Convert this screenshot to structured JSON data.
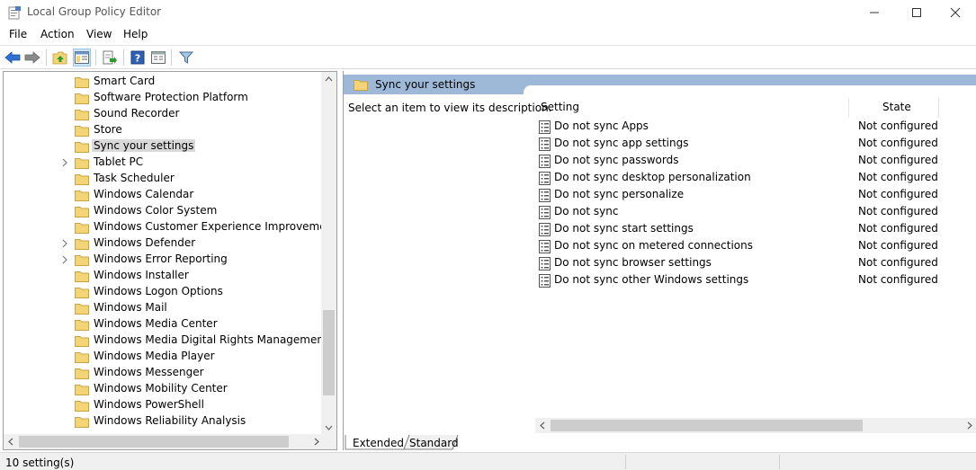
{
  "window": {
    "title": "Local Group Policy Editor"
  },
  "menu": {
    "items": [
      "File",
      "Action",
      "View",
      "Help"
    ]
  },
  "toolbar": {
    "buttons": [
      {
        "icon": "back-arrow-icon"
      },
      {
        "icon": "forward-arrow-icon"
      },
      {
        "icon": "up-folder-icon"
      },
      {
        "icon": "show-hide-tree-icon"
      },
      {
        "icon": "export-list-icon"
      },
      {
        "icon": "help-icon"
      },
      {
        "icon": "extended-view-icon"
      },
      {
        "icon": "filter-icon"
      }
    ]
  },
  "tree": {
    "items": [
      {
        "label": "Smart Card",
        "expandable": false,
        "selected": false
      },
      {
        "label": "Software Protection Platform",
        "expandable": false,
        "selected": false
      },
      {
        "label": "Sound Recorder",
        "expandable": false,
        "selected": false
      },
      {
        "label": "Store",
        "expandable": false,
        "selected": false
      },
      {
        "label": "Sync your settings",
        "expandable": false,
        "selected": true
      },
      {
        "label": "Tablet PC",
        "expandable": true,
        "selected": false
      },
      {
        "label": "Task Scheduler",
        "expandable": false,
        "selected": false
      },
      {
        "label": "Windows Calendar",
        "expandable": false,
        "selected": false
      },
      {
        "label": "Windows Color System",
        "expandable": false,
        "selected": false
      },
      {
        "label": "Windows Customer Experience Improvement Pro",
        "expandable": false,
        "selected": false
      },
      {
        "label": "Windows Defender",
        "expandable": true,
        "selected": false
      },
      {
        "label": "Windows Error Reporting",
        "expandable": true,
        "selected": false
      },
      {
        "label": "Windows Installer",
        "expandable": false,
        "selected": false
      },
      {
        "label": "Windows Logon Options",
        "expandable": false,
        "selected": false
      },
      {
        "label": "Windows Mail",
        "expandable": false,
        "selected": false
      },
      {
        "label": "Windows Media Center",
        "expandable": false,
        "selected": false
      },
      {
        "label": "Windows Media Digital Rights Management",
        "expandable": false,
        "selected": false
      },
      {
        "label": "Windows Media Player",
        "expandable": false,
        "selected": false
      },
      {
        "label": "Windows Messenger",
        "expandable": false,
        "selected": false
      },
      {
        "label": "Windows Mobility Center",
        "expandable": false,
        "selected": false
      },
      {
        "label": "Windows PowerShell",
        "expandable": false,
        "selected": false
      },
      {
        "label": "Windows Reliability Analysis",
        "expandable": false,
        "selected": false
      }
    ]
  },
  "details": {
    "header_title": "Sync your settings",
    "description_hint": "Select an item to view its description.",
    "columns": {
      "setting": "Setting",
      "state": "State"
    },
    "rows": [
      {
        "name": "Do not sync Apps",
        "state": "Not configured"
      },
      {
        "name": "Do not sync app settings",
        "state": "Not configured"
      },
      {
        "name": "Do not sync passwords",
        "state": "Not configured"
      },
      {
        "name": "Do not sync desktop personalization",
        "state": "Not configured"
      },
      {
        "name": "Do not sync personalize",
        "state": "Not configured"
      },
      {
        "name": "Do not sync",
        "state": "Not configured"
      },
      {
        "name": "Do not sync start settings",
        "state": "Not configured"
      },
      {
        "name": "Do not sync on metered connections",
        "state": "Not configured"
      },
      {
        "name": "Do not sync browser settings",
        "state": "Not configured"
      },
      {
        "name": "Do not sync other Windows settings",
        "state": "Not configured"
      }
    ]
  },
  "tabs": {
    "extended": "Extended",
    "standard": "Standard",
    "active": "Extended"
  },
  "status": {
    "text": "10 setting(s)"
  },
  "colors": {
    "header_blue": "#9db9d7",
    "folder_yellow": "#f3d477",
    "selection_gray": "#d9d9d9"
  }
}
